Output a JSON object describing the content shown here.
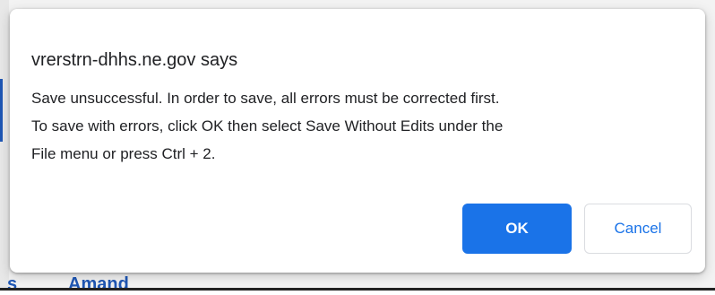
{
  "background": {
    "partial_text_left": "s",
    "partial_text": "Amand",
    "colors": {
      "link_blue": "#1f57b5"
    }
  },
  "dialog": {
    "title": "vrerstrn-dhhs.ne.gov says",
    "message_lines": [
      "Save unsuccessful.  In order to save, all errors must be corrected first.",
      "To save with errors, click OK then select Save Without Edits under the",
      "File menu or press Ctrl + 2."
    ],
    "ok_label": "OK",
    "cancel_label": "Cancel",
    "colors": {
      "primary": "#1a73e8",
      "text": "#202124"
    }
  }
}
